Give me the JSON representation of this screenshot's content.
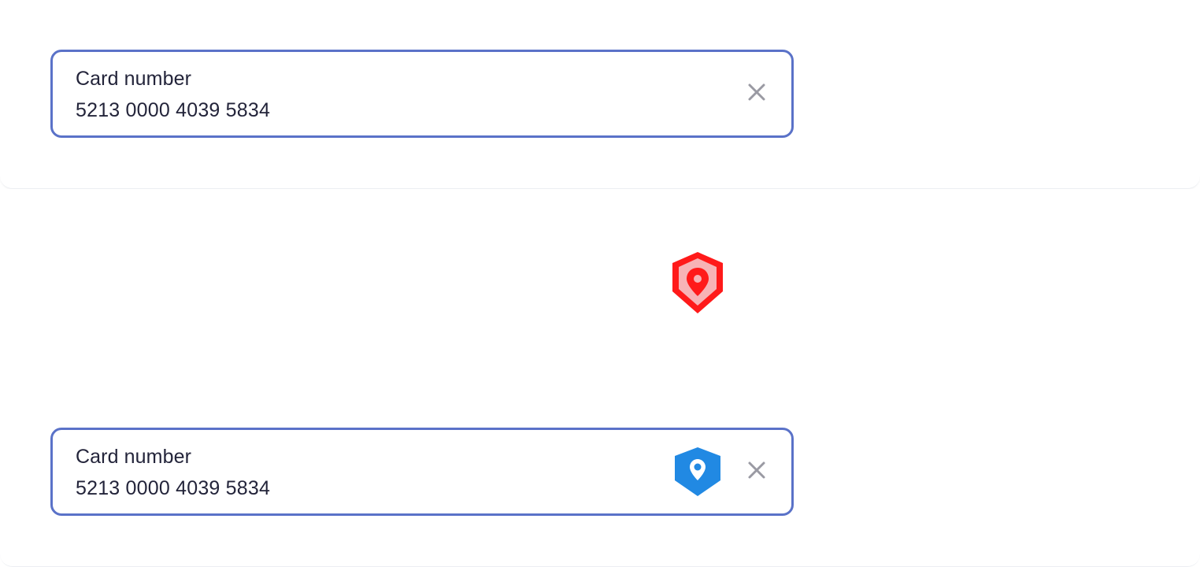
{
  "fields": [
    {
      "label": "Card number",
      "value": "5213 0000 4039 5834",
      "clear_icon": "close-icon"
    },
    {
      "label": "Card number",
      "value": "5213 0000 4039 5834",
      "badge_icon": "shield-location-icon",
      "clear_icon": "close-icon"
    }
  ],
  "floating_icon": "shield-location-icon",
  "colors": {
    "field_border": "#5a72c8",
    "text": "#23243a",
    "clear_icon": "#9a9aa3",
    "shield_blue": "#2189e3",
    "shield_red": "#ff1a1a"
  }
}
